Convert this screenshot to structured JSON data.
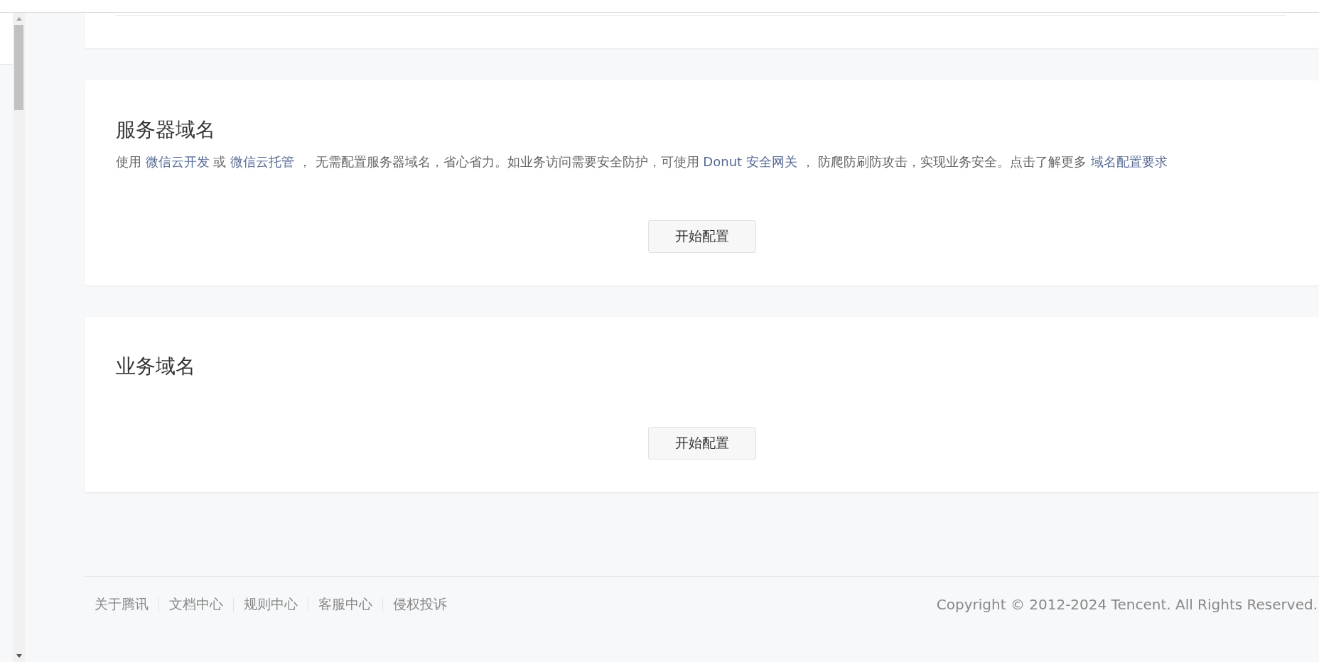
{
  "sections": [
    {
      "title": "服务器域名",
      "description": [
        {
          "kind": "text",
          "text": "使用 "
        },
        {
          "kind": "link",
          "text": "微信云开发"
        },
        {
          "kind": "text",
          "text": " 或 "
        },
        {
          "kind": "link",
          "text": "微信云托管"
        },
        {
          "kind": "text",
          "text": " ， 无需配置服务器域名，省心省力。如业务访问需要安全防护，可使用 "
        },
        {
          "kind": "link",
          "text": "Donut 安全网关"
        },
        {
          "kind": "text",
          "text": " ， 防爬防刷防攻击，实现业务安全。点击了解更多 "
        },
        {
          "kind": "link",
          "text": "域名配置要求"
        }
      ],
      "button": "开始配置"
    },
    {
      "title": "业务域名",
      "button": "开始配置"
    }
  ],
  "footer": {
    "links": [
      "关于腾讯",
      "文档中心",
      "规则中心",
      "客服中心",
      "侵权投诉"
    ],
    "copyright": "Copyright © 2012-2024 Tencent. All Rights Reserved."
  }
}
